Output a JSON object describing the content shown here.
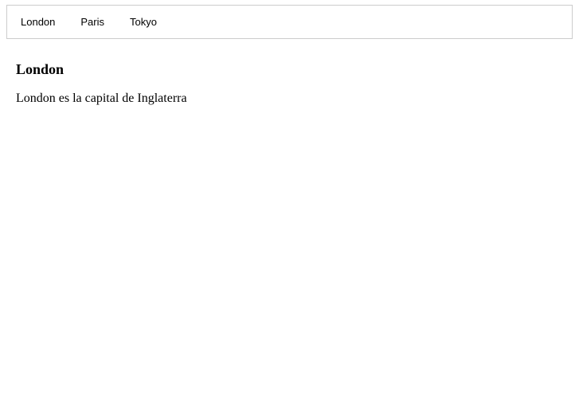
{
  "tabs": [
    {
      "label": "London"
    },
    {
      "label": "Paris"
    },
    {
      "label": "Tokyo"
    }
  ],
  "active_tab": {
    "title": "London",
    "text": "London es la capital de Inglaterra"
  }
}
